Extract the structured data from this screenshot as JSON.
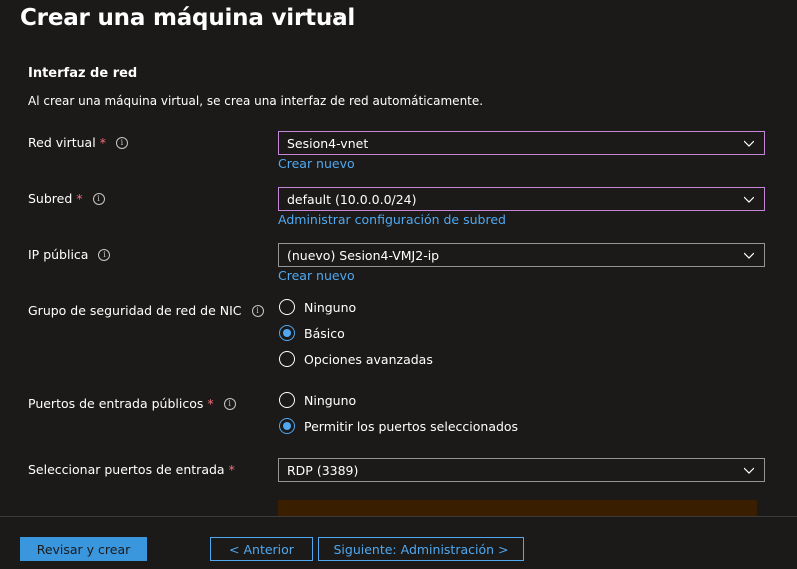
{
  "header": {
    "title": "Crear una máquina virtual",
    "more_label": "···"
  },
  "section": {
    "title": "Interfaz de red",
    "description": "Al crear una máquina virtual, se crea una interfaz de red automáticamente."
  },
  "fields": {
    "virtual_network": {
      "label": "Red virtual",
      "required": "*",
      "value": "Sesion4-vnet",
      "link": "Crear nuevo"
    },
    "subnet": {
      "label": "Subred",
      "required": "*",
      "value": "default (10.0.0.0/24)",
      "link": "Administrar configuración de subred"
    },
    "public_ip": {
      "label": "IP pública",
      "value": "(nuevo) Sesion4-VMJ2-ip",
      "link": "Crear nuevo"
    },
    "nic_nsg": {
      "label": "Grupo de seguridad de red de NIC",
      "options": [
        "Ninguno",
        "Básico",
        "Opciones avanzadas"
      ],
      "selected": "Básico"
    },
    "public_inbound_ports": {
      "label": "Puertos de entrada públicos",
      "required": "*",
      "options": [
        "Ninguno",
        "Permitir los puertos seleccionados"
      ],
      "selected": "Permitir los puertos seleccionados"
    },
    "select_inbound_ports": {
      "label": "Seleccionar puertos de entrada",
      "required": "*",
      "value": "RDP (3389)"
    }
  },
  "footer": {
    "review_create": "Revisar y crear",
    "previous": "< Anterior",
    "next": "Siguiente: Administración >"
  },
  "colors": {
    "background": "#1b1a19",
    "link": "#4fa8f0",
    "primary_button": "#3a96dd",
    "focus_border": "#c586d8",
    "required": "#f1707b",
    "warning_box": "#3a1e00"
  }
}
